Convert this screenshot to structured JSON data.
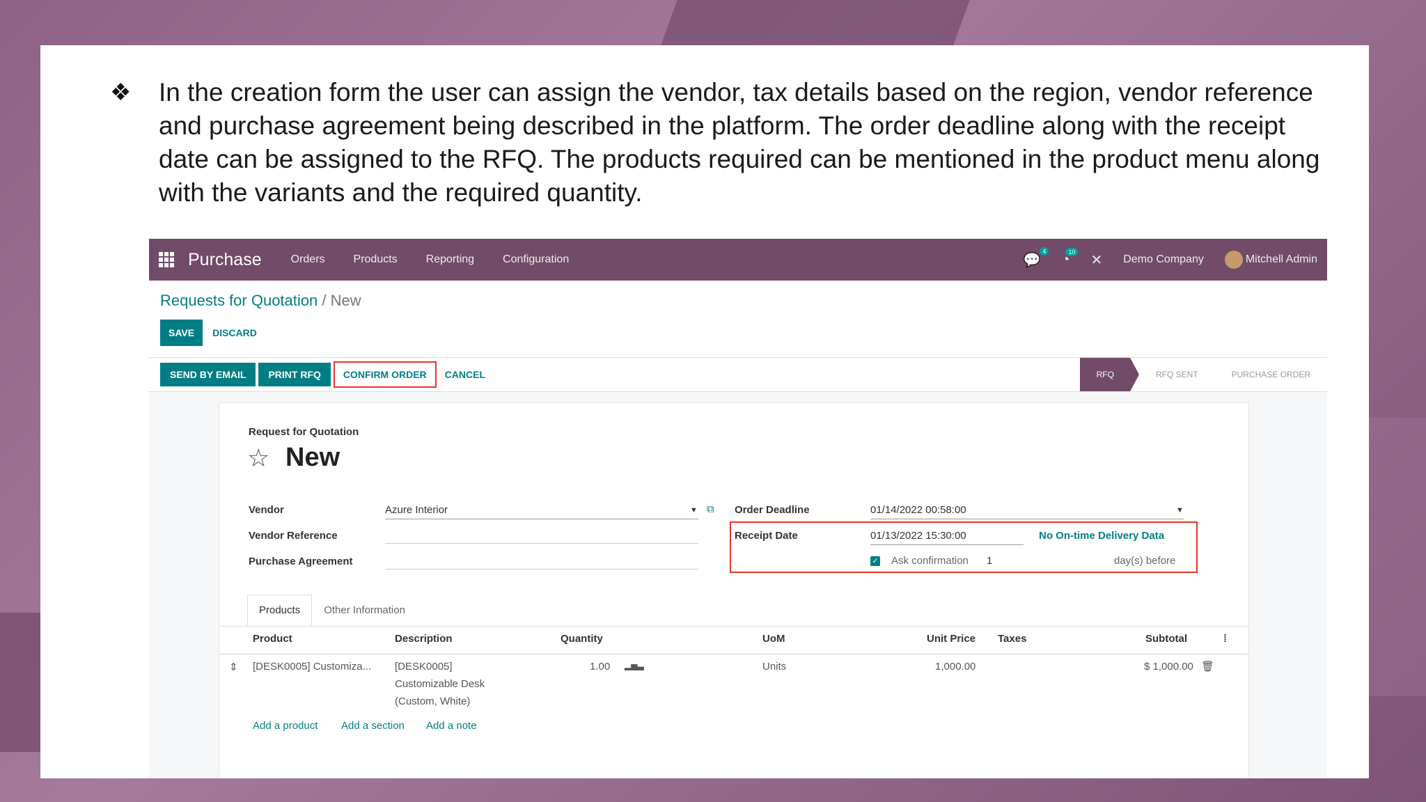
{
  "slide": {
    "bullet_symbol": "❖",
    "text": "In the creation form the user can assign the vendor, tax details based on the region, vendor reference and purchase agreement being described in the platform. The order deadline along with the receipt date can be assigned to the RFQ. The products required can be mentioned in the product menu along with the variants and the required quantity."
  },
  "navbar": {
    "app_name": "Purchase",
    "menu": [
      "Orders",
      "Products",
      "Reporting",
      "Configuration"
    ],
    "messages_badge": "4",
    "activities_badge": "10",
    "company": "Demo Company",
    "user": "Mitchell Admin"
  },
  "breadcrumb": {
    "parent": "Requests for Quotation",
    "separator": "/",
    "current": "New"
  },
  "control_buttons": {
    "save": "SAVE",
    "discard": "DISCARD"
  },
  "statusbar": {
    "buttons": [
      "SEND BY EMAIL",
      "PRINT RFQ"
    ],
    "confirm": "CONFIRM ORDER",
    "cancel": "CANCEL",
    "stages": [
      "RFQ",
      "RFQ SENT",
      "PURCHASE ORDER"
    ]
  },
  "form": {
    "subtitle": "Request for Quotation",
    "title": "New",
    "vendor_label": "Vendor",
    "vendor_value": "Azure Interior",
    "vendor_ref_label": "Vendor Reference",
    "agreement_label": "Purchase Agreement",
    "deadline_label": "Order Deadline",
    "deadline_value": "01/14/2022 00:58:00",
    "receipt_label": "Receipt Date",
    "receipt_value": "01/13/2022 15:30:00",
    "ontime_link": "No On-time Delivery Data",
    "ask_confirmation": "Ask confirmation",
    "ask_days": "1",
    "days_before": "day(s) before"
  },
  "tabs": [
    "Products",
    "Other Information"
  ],
  "table": {
    "headers": [
      "Product",
      "Description",
      "Quantity",
      "UoM",
      "Unit Price",
      "Taxes",
      "Subtotal"
    ],
    "row": {
      "product": "[DESK0005] Customiza...",
      "description_lines": [
        "[DESK0005]",
        "Customizable Desk",
        "(Custom, White)"
      ],
      "quantity": "1.00",
      "uom": "Units",
      "unit_price": "1,000.00",
      "subtotal": "$ 1,000.00"
    },
    "add_links": [
      "Add a product",
      "Add a section",
      "Add a note"
    ]
  }
}
